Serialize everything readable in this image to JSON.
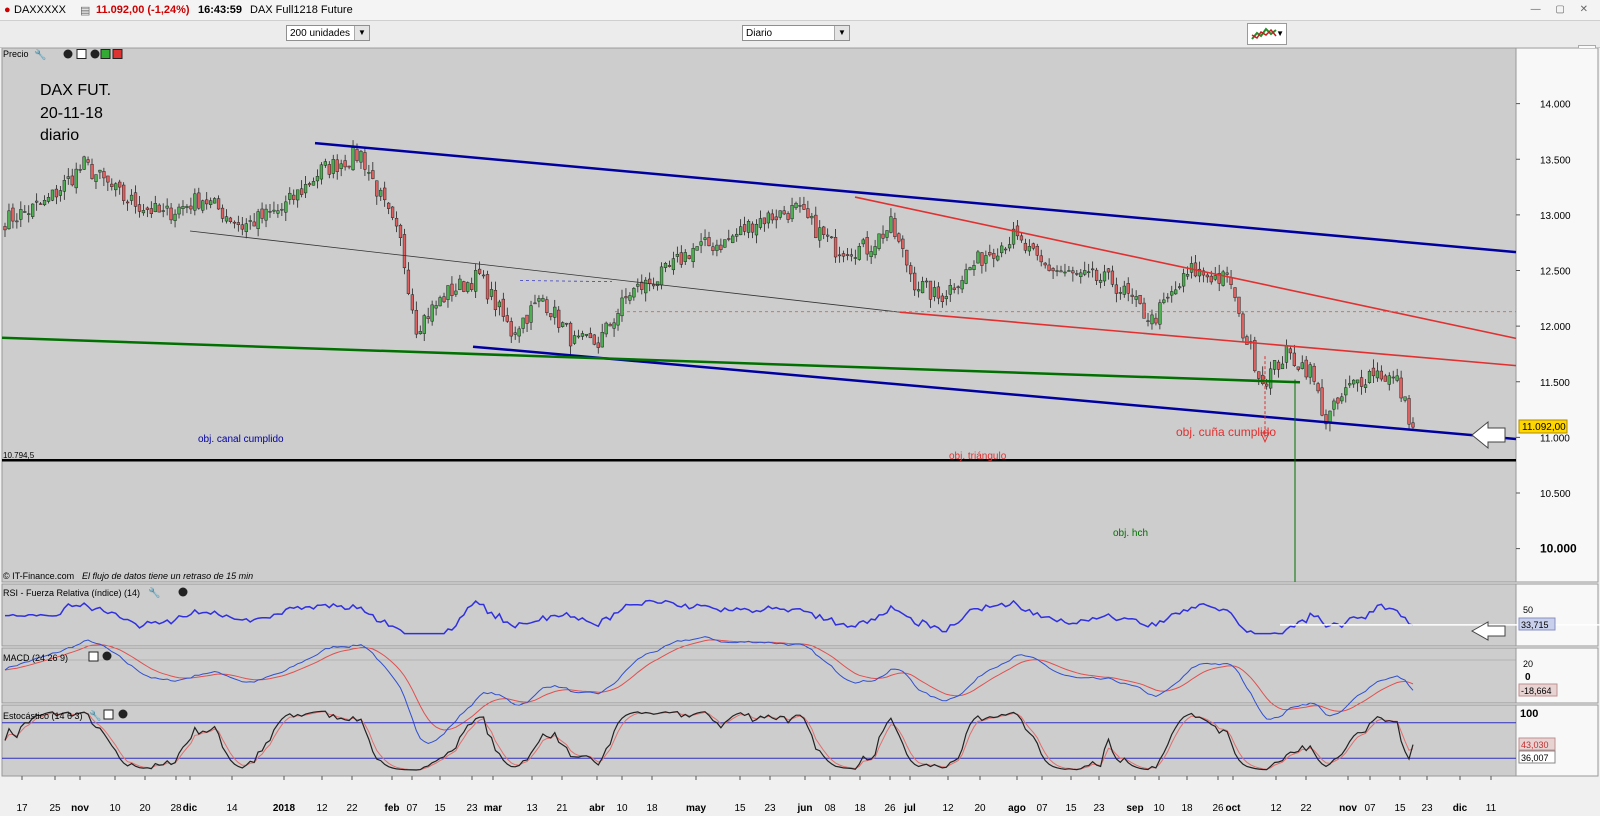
{
  "window": {
    "symbol": "DAXXXXX",
    "price_change": "11.092,00 (-1,24%)",
    "time": "16:43:59",
    "instrument": "DAX Full1218 Future"
  },
  "toolbar": {
    "units_select": "200 unidades",
    "period_select": "Diario"
  },
  "price_panel": {
    "label": "Precio",
    "annotation_title": [
      "DAX FUT.",
      "20-11-18",
      "diario"
    ],
    "level_label": "10.794,5",
    "last_price_badge": "11.092,00",
    "notes": {
      "channel": "obj. canal cumplido",
      "triangle": "obj. triángulo",
      "wedge": "obj. cuña cumplido",
      "hch": "obj. hch"
    },
    "source_text": "© IT-Finance.com",
    "delay_text": "El flujo de datos tiene un retraso de 15 min",
    "y_ticks": [
      "14.000",
      "13.500",
      "13.000",
      "12.500",
      "12.000",
      "11.500",
      "11.000",
      "10.500",
      "10.000"
    ]
  },
  "rsi_panel": {
    "label": "RSI - Fuerza Relativa (índice) (14)",
    "tick": "50",
    "value_badge": "33,715"
  },
  "macd_panel": {
    "label": "MACD (24 26 9)",
    "ticks": [
      "20",
      "0"
    ],
    "value_badge": "-18,664"
  },
  "stoch_panel": {
    "label": "Estocástico (14 6 3)",
    "tick": "100",
    "value_badges": [
      "43,030",
      "36,007"
    ]
  },
  "x_axis": {
    "labels": [
      {
        "t": "17",
        "b": false
      },
      {
        "t": "25",
        "b": false
      },
      {
        "t": "nov",
        "b": true
      },
      {
        "t": "10",
        "b": false
      },
      {
        "t": "20",
        "b": false
      },
      {
        "t": "28",
        "b": false
      },
      {
        "t": "dic",
        "b": true
      },
      {
        "t": "14",
        "b": false
      },
      {
        "t": "2018",
        "b": true
      },
      {
        "t": "12",
        "b": false
      },
      {
        "t": "22",
        "b": false
      },
      {
        "t": "feb",
        "b": true
      },
      {
        "t": "07",
        "b": false
      },
      {
        "t": "15",
        "b": false
      },
      {
        "t": "23",
        "b": false
      },
      {
        "t": "mar",
        "b": true
      },
      {
        "t": "13",
        "b": false
      },
      {
        "t": "21",
        "b": false
      },
      {
        "t": "abr",
        "b": true
      },
      {
        "t": "10",
        "b": false
      },
      {
        "t": "18",
        "b": false
      },
      {
        "t": "may",
        "b": true
      },
      {
        "t": "15",
        "b": false
      },
      {
        "t": "23",
        "b": false
      },
      {
        "t": "jun",
        "b": true
      },
      {
        "t": "08",
        "b": false
      },
      {
        "t": "18",
        "b": false
      },
      {
        "t": "26",
        "b": false
      },
      {
        "t": "jul",
        "b": true
      },
      {
        "t": "12",
        "b": false
      },
      {
        "t": "20",
        "b": false
      },
      {
        "t": "ago",
        "b": true
      },
      {
        "t": "07",
        "b": false
      },
      {
        "t": "15",
        "b": false
      },
      {
        "t": "23",
        "b": false
      },
      {
        "t": "sep",
        "b": true
      },
      {
        "t": "10",
        "b": false
      },
      {
        "t": "18",
        "b": false
      },
      {
        "t": "26",
        "b": false
      },
      {
        "t": "oct",
        "b": true
      },
      {
        "t": "12",
        "b": false
      },
      {
        "t": "22",
        "b": false
      },
      {
        "t": "nov",
        "b": true
      },
      {
        "t": "07",
        "b": false
      },
      {
        "t": "15",
        "b": false
      },
      {
        "t": "23",
        "b": false
      },
      {
        "t": "dic",
        "b": true
      },
      {
        "t": "11",
        "b": false
      }
    ]
  },
  "colors": {
    "bull": "#4caf50",
    "bear": "#e06060",
    "channel": "#0000a0",
    "wedge": "#e03030",
    "support": "#007000",
    "rsi": "#3030e0",
    "macd": "#3050d0",
    "signal": "#e05050",
    "badge": "#ffd700"
  },
  "chart_data": {
    "type": "candlestick",
    "period": "Diario",
    "ylim": [
      9700,
      14500
    ],
    "last": 11092,
    "horizontal_level": 10794.5,
    "close_anchors": [
      [
        0,
        12950
      ],
      [
        10,
        13100
      ],
      [
        20,
        13450
      ],
      [
        30,
        13150
      ],
      [
        40,
        13000
      ],
      [
        50,
        13150
      ],
      [
        60,
        12900
      ],
      [
        70,
        13050
      ],
      [
        80,
        13400
      ],
      [
        90,
        13550
      ],
      [
        100,
        12750
      ],
      [
        104,
        12000
      ],
      [
        112,
        12300
      ],
      [
        120,
        12450
      ],
      [
        128,
        11950
      ],
      [
        136,
        12250
      ],
      [
        144,
        11850
      ],
      [
        150,
        11850
      ],
      [
        158,
        12300
      ],
      [
        166,
        12450
      ],
      [
        174,
        12700
      ],
      [
        182,
        12750
      ],
      [
        190,
        12950
      ],
      [
        200,
        13050
      ],
      [
        210,
        12700
      ],
      [
        218,
        12700
      ],
      [
        224,
        12900
      ],
      [
        230,
        12400
      ],
      [
        236,
        12250
      ],
      [
        242,
        12450
      ],
      [
        248,
        12650
      ],
      [
        255,
        12800
      ],
      [
        262,
        12550
      ],
      [
        270,
        12450
      ],
      [
        280,
        12400
      ],
      [
        290,
        12050
      ],
      [
        300,
        12500
      ],
      [
        310,
        12400
      ],
      [
        312,
        12050
      ],
      [
        318,
        11500
      ],
      [
        324,
        11750
      ],
      [
        330,
        11600
      ],
      [
        334,
        11150
      ],
      [
        340,
        11450
      ],
      [
        346,
        11600
      ],
      [
        352,
        11500
      ],
      [
        356,
        11092
      ]
    ],
    "rsi": {
      "period": 14,
      "last": 33.715,
      "ylim": [
        0,
        100
      ]
    },
    "macd": {
      "params": [
        24,
        26,
        9
      ],
      "last": -18.664,
      "ylim": [
        -60,
        40
      ]
    },
    "stochastic": {
      "params": [
        14,
        6,
        3
      ],
      "k_last": 43.03,
      "d_last": 36.007,
      "ylim": [
        -10,
        110
      ]
    }
  }
}
